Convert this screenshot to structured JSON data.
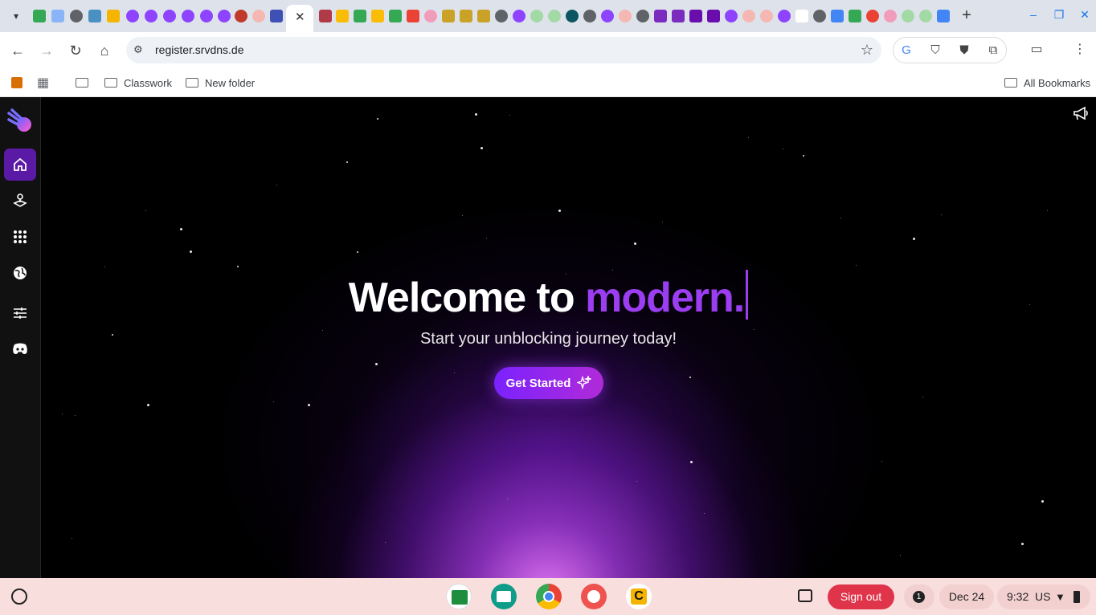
{
  "browser": {
    "active_tab_close": "✕",
    "new_tab_label": "+",
    "url": "register.srvdns.de",
    "bookmarks": [
      "Classwork",
      "New folder"
    ],
    "all_bookmarks": "All Bookmarks"
  },
  "sidebar": {
    "items": [
      "home-icon",
      "gamepad-icon",
      "apps-grid-icon",
      "globe-icon",
      "settings-sliders-icon",
      "discord-icon"
    ]
  },
  "hero": {
    "title_main": "Welcome to ",
    "title_accent": "modern.",
    "subtitle": "Start your unblocking journey today!",
    "cta_label": "Get Started"
  },
  "shelf": {
    "sign_out": "Sign out",
    "notifications_count": "1",
    "date": "Dec 24",
    "time": "9:32",
    "locale": "US"
  },
  "colors": {
    "accent": "#9b3df0",
    "sidebar_active": "#5b1aa6",
    "sign_out": "#e0344a"
  }
}
